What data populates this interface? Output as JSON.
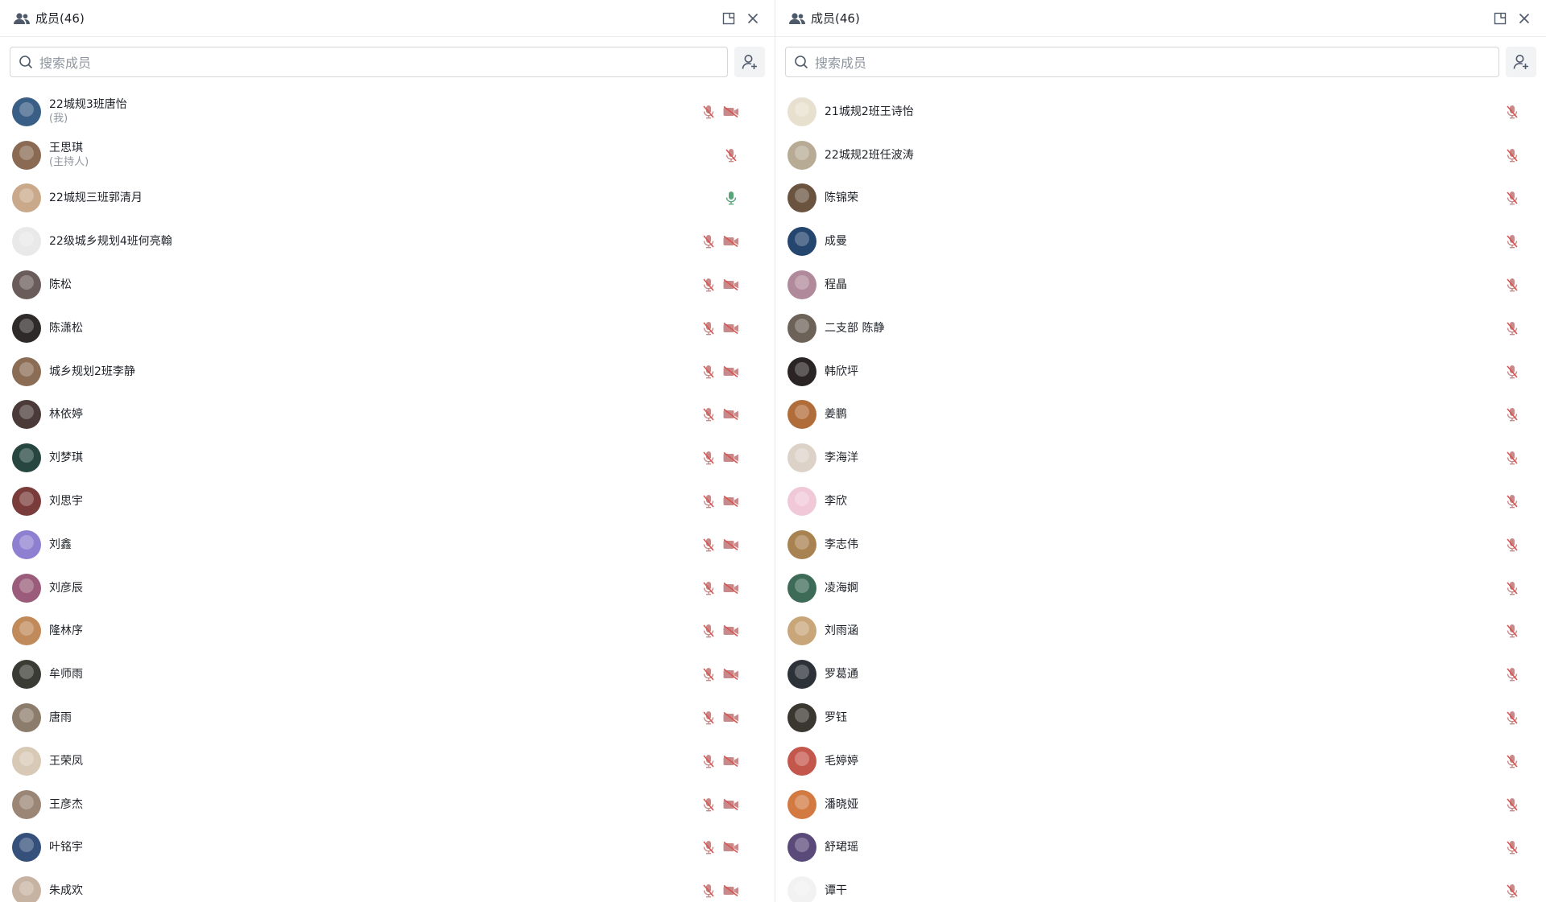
{
  "left_panel": {
    "title": "成员(46)",
    "search_placeholder": "搜索成员",
    "members": [
      {
        "name": "22城规3班唐怡",
        "tag": "(我)",
        "mic": "muted",
        "video": "off",
        "color": "#3a5f86"
      },
      {
        "name": "王思琪",
        "tag": "(主持人)",
        "mic": "muted",
        "video": "none",
        "color": "#8a6a52"
      },
      {
        "name": "22城规三班郭清月",
        "tag": "",
        "mic": "on",
        "video": "none",
        "color": "#c9a98a"
      },
      {
        "name": "22级城乡规划4班何亮翰",
        "tag": "",
        "mic": "muted",
        "video": "off",
        "color": "#e9e9e9"
      },
      {
        "name": "陈松",
        "tag": "",
        "mic": "muted",
        "video": "off",
        "color": "#6b5c5c"
      },
      {
        "name": "陈潇松",
        "tag": "",
        "mic": "muted",
        "video": "off",
        "color": "#2f2a2a"
      },
      {
        "name": "城乡规划2班李静",
        "tag": "",
        "mic": "muted",
        "video": "off",
        "color": "#8b6d55"
      },
      {
        "name": "林依婷",
        "tag": "",
        "mic": "muted",
        "video": "off",
        "color": "#4a3b38"
      },
      {
        "name": "刘梦琪",
        "tag": "",
        "mic": "muted",
        "video": "off",
        "color": "#26463f"
      },
      {
        "name": "刘思宇",
        "tag": "",
        "mic": "muted",
        "video": "off",
        "color": "#7a3c3a"
      },
      {
        "name": "刘鑫",
        "tag": "",
        "mic": "muted",
        "video": "off",
        "color": "#8f7fd0"
      },
      {
        "name": "刘彦辰",
        "tag": "",
        "mic": "muted",
        "video": "off",
        "color": "#9a5c7a"
      },
      {
        "name": "隆林序",
        "tag": "",
        "mic": "muted",
        "video": "off",
        "color": "#c08a5a"
      },
      {
        "name": "牟师雨",
        "tag": "",
        "mic": "muted",
        "video": "off",
        "color": "#3b3b36"
      },
      {
        "name": "唐雨",
        "tag": "",
        "mic": "muted",
        "video": "off",
        "color": "#8c7c6c"
      },
      {
        "name": "王荣凤",
        "tag": "",
        "mic": "muted",
        "video": "off",
        "color": "#d8c9b6"
      },
      {
        "name": "王彦杰",
        "tag": "",
        "mic": "muted",
        "video": "off",
        "color": "#9b8676"
      },
      {
        "name": "叶铭宇",
        "tag": "",
        "mic": "muted",
        "video": "off",
        "color": "#35507a"
      },
      {
        "name": "朱成欢",
        "tag": "",
        "mic": "muted",
        "video": "off",
        "color": "#c7b3a2"
      }
    ]
  },
  "right_panel": {
    "title": "成员(46)",
    "search_placeholder": "搜索成员",
    "members": [
      {
        "name": "21城规2班王诗怡",
        "mic": "muted",
        "color": "#e8e0cf"
      },
      {
        "name": "22城规2班任波涛",
        "mic": "muted",
        "color": "#b7ab96"
      },
      {
        "name": "陈锦荣",
        "mic": "muted",
        "color": "#6a5440"
      },
      {
        "name": "成曼",
        "mic": "muted",
        "color": "#24456e"
      },
      {
        "name": "程晶",
        "mic": "muted",
        "color": "#b08a9a"
      },
      {
        "name": "二支部 陈静",
        "mic": "muted",
        "color": "#6d6258"
      },
      {
        "name": "韩欣坪",
        "mic": "muted",
        "color": "#2a2424"
      },
      {
        "name": "姜鹏",
        "mic": "muted",
        "color": "#b06d3a"
      },
      {
        "name": "李海洋",
        "mic": "muted",
        "color": "#dcd2c8"
      },
      {
        "name": "李欣",
        "mic": "muted",
        "color": "#f0c8d8"
      },
      {
        "name": "李志伟",
        "mic": "muted",
        "color": "#a88250"
      },
      {
        "name": "凌海婀",
        "mic": "muted",
        "color": "#3d6b58"
      },
      {
        "name": "刘雨涵",
        "mic": "muted",
        "color": "#c9a67a"
      },
      {
        "name": "罗葛通",
        "mic": "muted",
        "color": "#2d3238"
      },
      {
        "name": "罗钰",
        "mic": "muted",
        "color": "#3a3630"
      },
      {
        "name": "毛婷婷",
        "mic": "muted",
        "color": "#c4574c"
      },
      {
        "name": "潘晓娅",
        "mic": "muted",
        "color": "#d27a42"
      },
      {
        "name": "舒珺瑶",
        "mic": "muted",
        "color": "#5a4a7a"
      },
      {
        "name": "谭干",
        "mic": "muted",
        "color": "#f2f2f2"
      }
    ]
  }
}
